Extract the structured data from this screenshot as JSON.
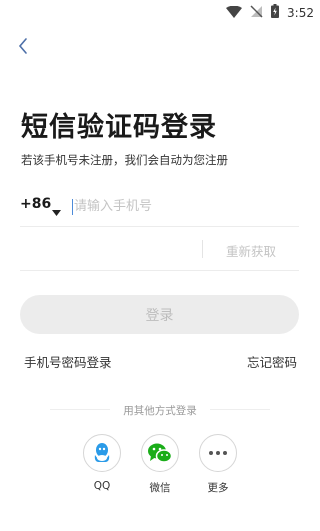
{
  "status_bar": {
    "time": "3:52",
    "icons": [
      "wifi-icon",
      "no-signal-icon",
      "battery-charging-icon"
    ]
  },
  "nav": {
    "back_icon": "chevron-left-icon"
  },
  "page": {
    "title": "短信验证码登录",
    "subtitle": "若该手机号未注册，我们会自动为您注册"
  },
  "phone": {
    "country_code": "+86",
    "placeholder": "请输入手机号",
    "value": ""
  },
  "code": {
    "resend_label": "重新获取"
  },
  "login_button": {
    "label": "登录"
  },
  "links": {
    "password_login": "手机号密码登录",
    "forgot_password": "忘记密码"
  },
  "other_login": {
    "title": "用其他方式登录",
    "options": [
      {
        "label": "QQ",
        "icon": "qq-penguin-icon",
        "color": "#2b9be8"
      },
      {
        "label": "微信",
        "icon": "wechat-icon",
        "color": "#1aad19"
      },
      {
        "label": "更多",
        "icon": "more-dots-icon",
        "color": "#555555"
      }
    ]
  },
  "colors": {
    "accent": "#4d8bd9",
    "button_bg": "#ececec",
    "button_text": "#bdbdbd",
    "placeholder": "#c4c4c4"
  }
}
